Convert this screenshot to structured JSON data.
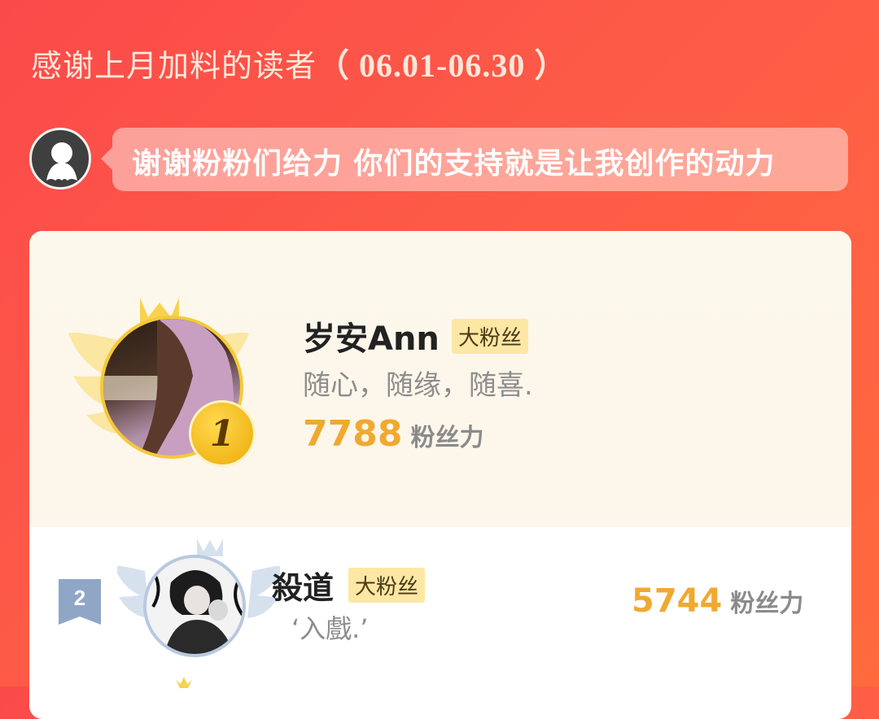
{
  "header": {
    "title": "感谢上月加料的读者",
    "date_range": "（ 06.01-06.30 ）"
  },
  "author": {
    "avatar_icon": "ghost-avatar-icon",
    "message": "谢谢粉粉们给力 你们的支持就是让我创作的动力"
  },
  "ranking": [
    {
      "rank": "1",
      "name": "岁安Ann",
      "badge": "大粉丝",
      "motto": "随心，随缘，随喜.",
      "score": "7788",
      "score_unit": "粉丝力"
    },
    {
      "rank": "2",
      "name": "殺道",
      "badge": "大粉丝",
      "motto": "‘入戲.’",
      "score": "5744",
      "score_unit": "粉丝力"
    }
  ],
  "colors": {
    "background": "#fb4a4a",
    "gold": "#f0a930",
    "badge_bg": "#fde7a4",
    "card_top": "#fdf8ec"
  }
}
